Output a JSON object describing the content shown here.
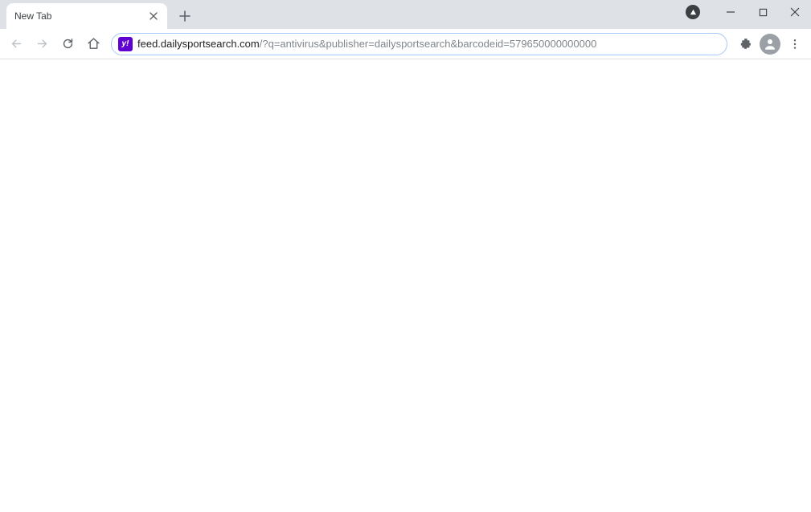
{
  "tab": {
    "title": "New Tab"
  },
  "address": {
    "host": "feed.dailysportsearch.com",
    "path": "/?q=antivirus&publisher=dailysportsearch&barcodeid=579650000000000"
  },
  "icons": {
    "site": "y!"
  }
}
